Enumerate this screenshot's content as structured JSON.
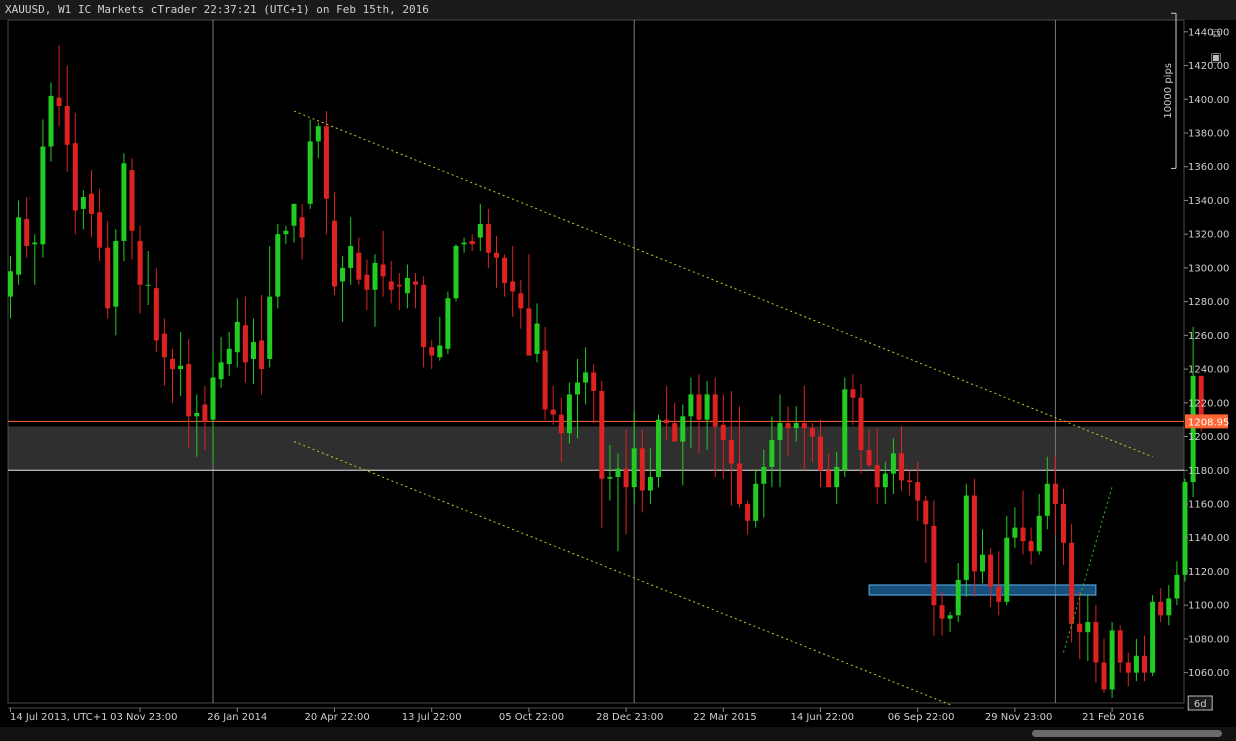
{
  "window": {
    "title": "XAUUSD, W1 IC Markets cTrader 22:37:21 (UTC+1) on Feb 15th, 2016"
  },
  "toolbar": {
    "expand_icon": "external-link-icon",
    "camera_icon": "camera-icon"
  },
  "colors": {
    "bullish": "#22cc22",
    "bearish": "#dd2222",
    "price_line": "#ff6633",
    "trendline": "#c8c832",
    "zone_fill": "#555555",
    "box_fill": "#1f6aa5",
    "box_stroke": "#5fb4e8"
  },
  "chart_data": {
    "type": "candlestick",
    "symbol": "XAUUSD",
    "timeframe": "W1",
    "ylim": [
      1042,
      1447
    ],
    "y_ticks": [
      "1060.00",
      "1080.00",
      "1100.00",
      "1120.00",
      "1140.00",
      "1160.00",
      "1180.00",
      "1200.00",
      "1220.00",
      "1240.00",
      "1260.00",
      "1280.00",
      "1300.00",
      "1320.00",
      "1340.00",
      "1360.00",
      "1380.00",
      "1400.00",
      "1420.00",
      "1440.00"
    ],
    "x_labels": [
      "14 Jul 2013, UTC+1",
      "03 Nov 23:00",
      "26 Jan 2014",
      "20 Apr 22:00",
      "13 Jul 22:00",
      "05 Oct 22:00",
      "28 Dec 23:00",
      "22 Mar 2015",
      "14 Jun 22:00",
      "06 Sep 22:00",
      "29 Nov 23:00",
      "21 Feb 2016"
    ],
    "x_label_candle_index": [
      0,
      16,
      28,
      40,
      52,
      64,
      76,
      88,
      100,
      112,
      124,
      136
    ],
    "current_price": "1208.95",
    "countdown_label": "6d",
    "ruler_label": "10000 pips",
    "ruler_range": [
      1359,
      1451
    ],
    "horizontal_lines": [
      1209,
      1180
    ],
    "zone": [
      1180,
      1206
    ],
    "box": {
      "from_index": 106,
      "to_index": 134,
      "low": 1106,
      "high": 1112
    },
    "vertical_lines_at_index": [
      25,
      77,
      129
    ],
    "trendlines": [
      {
        "from": [
          35,
          1393
        ],
        "to": [
          141,
          1188
        ],
        "color": "trendline"
      },
      {
        "from": [
          35,
          1197
        ],
        "to": [
          116,
          1041
        ],
        "color": "trendline"
      },
      {
        "from": [
          130,
          1072
        ],
        "to": [
          136,
          1170
        ],
        "color": "bullish"
      }
    ],
    "candles": [
      [
        1283,
        1298,
        1270,
        1307
      ],
      [
        1296,
        1330,
        1290,
        1340
      ],
      [
        1329,
        1313,
        1306,
        1342
      ],
      [
        1314,
        1315,
        1290,
        1320
      ],
      [
        1314,
        1372,
        1306,
        1388
      ],
      [
        1372,
        1402,
        1363,
        1410
      ],
      [
        1401,
        1396,
        1384,
        1432
      ],
      [
        1396,
        1373,
        1357,
        1420
      ],
      [
        1374,
        1334,
        1320,
        1392
      ],
      [
        1335,
        1342,
        1323,
        1346
      ],
      [
        1344,
        1332,
        1318,
        1358
      ],
      [
        1333,
        1312,
        1304,
        1347
      ],
      [
        1312,
        1276,
        1270,
        1328
      ],
      [
        1277,
        1316,
        1260,
        1323
      ],
      [
        1316,
        1362,
        1304,
        1368
      ],
      [
        1358,
        1322,
        1305,
        1365
      ],
      [
        1316,
        1290,
        1273,
        1325
      ],
      [
        1290,
        1290,
        1278,
        1310
      ],
      [
        1288,
        1257,
        1250,
        1300
      ],
      [
        1261,
        1247,
        1230,
        1270
      ],
      [
        1246,
        1240,
        1220,
        1252
      ],
      [
        1240,
        1242,
        1224,
        1262
      ],
      [
        1243,
        1212,
        1193,
        1258
      ],
      [
        1212,
        1214,
        1188,
        1225
      ],
      [
        1219,
        1209,
        1192,
        1230
      ],
      [
        1210,
        1235,
        1184,
        1250
      ],
      [
        1234,
        1244,
        1229,
        1259
      ],
      [
        1243,
        1252,
        1236,
        1262
      ],
      [
        1250,
        1268,
        1241,
        1282
      ],
      [
        1266,
        1244,
        1232,
        1283
      ],
      [
        1246,
        1256,
        1231,
        1270
      ],
      [
        1257,
        1240,
        1225,
        1284
      ],
      [
        1246,
        1283,
        1241,
        1313
      ],
      [
        1283,
        1320,
        1276,
        1326
      ],
      [
        1320,
        1322,
        1314,
        1325
      ],
      [
        1325,
        1338,
        1315,
        1338
      ],
      [
        1330,
        1318,
        1305,
        1338
      ],
      [
        1338,
        1375,
        1335,
        1388
      ],
      [
        1375,
        1384,
        1365,
        1386
      ],
      [
        1384,
        1341,
        1320,
        1393
      ],
      [
        1328,
        1289,
        1284,
        1345
      ],
      [
        1292,
        1300,
        1268,
        1307
      ],
      [
        1300,
        1313,
        1290,
        1330
      ],
      [
        1309,
        1293,
        1290,
        1318
      ],
      [
        1296,
        1287,
        1275,
        1305
      ],
      [
        1287,
        1303,
        1265,
        1308
      ],
      [
        1302,
        1295,
        1283,
        1322
      ],
      [
        1292,
        1287,
        1279,
        1304
      ],
      [
        1290,
        1289,
        1275,
        1297
      ],
      [
        1285,
        1294,
        1276,
        1302
      ],
      [
        1292,
        1290,
        1276,
        1297
      ],
      [
        1290,
        1253,
        1241,
        1295
      ],
      [
        1253,
        1248,
        1240,
        1257
      ],
      [
        1247,
        1254,
        1245,
        1271
      ],
      [
        1252,
        1282,
        1249,
        1286
      ],
      [
        1282,
        1313,
        1280,
        1314
      ],
      [
        1314,
        1315,
        1309,
        1318
      ],
      [
        1316,
        1314,
        1310,
        1320
      ],
      [
        1318,
        1326,
        1310,
        1338
      ],
      [
        1326,
        1309,
        1300,
        1335
      ],
      [
        1309,
        1306,
        1288,
        1319
      ],
      [
        1306,
        1291,
        1283,
        1308
      ],
      [
        1292,
        1286,
        1271,
        1313
      ],
      [
        1285,
        1276,
        1264,
        1293
      ],
      [
        1276,
        1248,
        1249,
        1308
      ],
      [
        1249,
        1267,
        1244,
        1279
      ],
      [
        1251,
        1216,
        1210,
        1265
      ],
      [
        1216,
        1213,
        1207,
        1230
      ],
      [
        1213,
        1202,
        1185,
        1223
      ],
      [
        1202,
        1225,
        1196,
        1232
      ],
      [
        1225,
        1232,
        1199,
        1246
      ],
      [
        1232,
        1238,
        1219,
        1253
      ],
      [
        1238,
        1227,
        1208,
        1243
      ],
      [
        1227,
        1175,
        1146,
        1233
      ],
      [
        1175,
        1176,
        1162,
        1195
      ],
      [
        1176,
        1181,
        1132,
        1190
      ],
      [
        1181,
        1170,
        1142,
        1204
      ],
      [
        1170,
        1193,
        1160,
        1215
      ],
      [
        1193,
        1168,
        1155,
        1204
      ],
      [
        1168,
        1176,
        1160,
        1193
      ],
      [
        1176,
        1210,
        1170,
        1213
      ],
      [
        1210,
        1208,
        1198,
        1230
      ],
      [
        1208,
        1197,
        1200,
        1220
      ],
      [
        1197,
        1212,
        1171,
        1219
      ],
      [
        1212,
        1225,
        1193,
        1235
      ],
      [
        1225,
        1210,
        1190,
        1237
      ],
      [
        1210,
        1225,
        1192,
        1233
      ],
      [
        1225,
        1206,
        1176,
        1235
      ],
      [
        1207,
        1198,
        1175,
        1225
      ],
      [
        1198,
        1184,
        1159,
        1227
      ],
      [
        1184,
        1160,
        1158,
        1218
      ],
      [
        1160,
        1150,
        1142,
        1162
      ],
      [
        1150,
        1172,
        1146,
        1180
      ],
      [
        1172,
        1182,
        1152,
        1192
      ],
      [
        1182,
        1198,
        1170,
        1212
      ],
      [
        1198,
        1208,
        1170,
        1225
      ],
      [
        1208,
        1205,
        1188,
        1218
      ],
      [
        1205,
        1208,
        1197,
        1218
      ],
      [
        1208,
        1205,
        1180,
        1230
      ],
      [
        1205,
        1200,
        1185,
        1208
      ],
      [
        1200,
        1180,
        1170,
        1210
      ],
      [
        1180,
        1170,
        1171,
        1190
      ],
      [
        1170,
        1182,
        1160,
        1191
      ],
      [
        1180,
        1228,
        1176,
        1235
      ],
      [
        1228,
        1223,
        1207,
        1237
      ],
      [
        1223,
        1192,
        1178,
        1231
      ],
      [
        1192,
        1183,
        1182,
        1204
      ],
      [
        1183,
        1170,
        1160,
        1205
      ],
      [
        1170,
        1178,
        1160,
        1185
      ],
      [
        1178,
        1190,
        1166,
        1199
      ],
      [
        1190,
        1174,
        1168,
        1206
      ],
      [
        1174,
        1173,
        1165,
        1180
      ],
      [
        1173,
        1162,
        1150,
        1185
      ],
      [
        1162,
        1148,
        1125,
        1165
      ],
      [
        1147,
        1100,
        1082,
        1162
      ],
      [
        1100,
        1092,
        1082,
        1108
      ],
      [
        1092,
        1094,
        1084,
        1096
      ],
      [
        1094,
        1115,
        1090,
        1125
      ],
      [
        1115,
        1165,
        1105,
        1172
      ],
      [
        1165,
        1120,
        1105,
        1175
      ],
      [
        1120,
        1130,
        1113,
        1145
      ],
      [
        1130,
        1111,
        1099,
        1134
      ],
      [
        1111,
        1102,
        1094,
        1132
      ],
      [
        1102,
        1140,
        1100,
        1153
      ],
      [
        1140,
        1146,
        1134,
        1158
      ],
      [
        1146,
        1138,
        1130,
        1168
      ],
      [
        1138,
        1132,
        1124,
        1146
      ],
      [
        1132,
        1153,
        1130,
        1166
      ],
      [
        1153,
        1172,
        1145,
        1188
      ],
      [
        1172,
        1160,
        1142,
        1188
      ],
      [
        1160,
        1137,
        1124,
        1169
      ],
      [
        1137,
        1089,
        1078,
        1148
      ],
      [
        1089,
        1084,
        1068,
        1108
      ],
      [
        1084,
        1090,
        1067,
        1106
      ],
      [
        1090,
        1066,
        1054,
        1100
      ],
      [
        1066,
        1050,
        1048,
        1080
      ],
      [
        1050,
        1085,
        1045,
        1090
      ],
      [
        1085,
        1066,
        1060,
        1088
      ],
      [
        1066,
        1060,
        1052,
        1072
      ],
      [
        1060,
        1070,
        1055,
        1080
      ],
      [
        1070,
        1060,
        1055,
        1082
      ],
      [
        1060,
        1102,
        1058,
        1106
      ],
      [
        1102,
        1094,
        1090,
        1110
      ],
      [
        1094,
        1104,
        1088,
        1112
      ],
      [
        1104,
        1118,
        1100,
        1126
      ],
      [
        1118,
        1173,
        1114,
        1175
      ],
      [
        1173,
        1236,
        1164,
        1265
      ],
      [
        1236,
        1209,
        1203,
        1235
      ]
    ]
  }
}
